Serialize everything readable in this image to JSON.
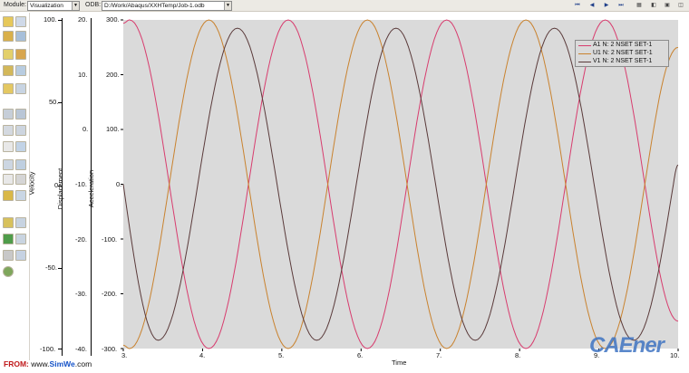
{
  "toolbar": {
    "module_label": "Module:",
    "module_value": "Visualization",
    "odb_label": "ODB:",
    "odb_value": "D:/Work/Abaqus/XXHTemp/Job-1.odb",
    "icons": [
      "first-frame-icon",
      "previous-frame-icon",
      "play-icon",
      "next-frame-icon",
      "last-frame-icon",
      "animation-options-icon",
      "animate-icon",
      "camera-icon",
      "capture-icon"
    ]
  },
  "toolbox": {
    "icons": [
      "plot-undeformed-icon",
      "plot-deformed-icon",
      "plot-contours-icon",
      "plot-symbols-icon",
      "plot-material-orientations-icon",
      "common-options-icon",
      "superimpose-options-icon",
      "field-output-icon",
      "create-xy-data-icon",
      "xy-data-manager-icon",
      "path-icon",
      "probe-values-icon",
      "query-icon",
      "view-cut-icon",
      "display-group-icon",
      "step-frame-icon",
      "animate-time-history-icon",
      "result-options-icon",
      "section-points-icon",
      "tools-icon"
    ]
  },
  "plot": {
    "x_axis_title": "Time",
    "x_ticks": [
      "3.",
      "4.",
      "5.",
      "6.",
      "7.",
      "8.",
      "9.",
      "10."
    ],
    "axes": [
      {
        "title": "Velocity",
        "ticks": [
          "100.",
          "50.",
          "0.",
          "-50.",
          "-100."
        ]
      },
      {
        "title": "Displacement",
        "ticks": [
          "20.",
          "10.",
          "0.",
          "-10.",
          "-20.",
          "-30.",
          "-40."
        ]
      },
      {
        "title": "Acceleration",
        "ticks": [
          "300.",
          "200.",
          "100.",
          "0.",
          "-100.",
          "-200.",
          "-300."
        ]
      }
    ],
    "legend": [
      {
        "label": "A1 N: 2 NSET SET-1",
        "color": "#d83c6e"
      },
      {
        "label": "U1 N: 2 NSET SET-1",
        "color": "#c9822e"
      },
      {
        "label": "V1 N: 2 NSET SET-1",
        "color": "#5a3a3a"
      }
    ]
  },
  "chart_data": {
    "type": "line",
    "title": "",
    "xlabel": "Time",
    "xlim": [
      3,
      10
    ],
    "grid": false,
    "background": "#dadada",
    "legend_position": "top-right",
    "y_axes": [
      {
        "label": "Velocity",
        "lim": [
          -100,
          100
        ]
      },
      {
        "label": "Displacement",
        "lim": [
          -40,
          20
        ]
      },
      {
        "label": "Acceleration",
        "lim": [
          -300,
          300
        ]
      }
    ],
    "series": [
      {
        "name": "A1 N: 2 NSET SET-1",
        "axis": "Acceleration",
        "color": "#d83c6e",
        "x": [
          3.0,
          3.08,
          3.58,
          4.08,
          4.58,
          5.08,
          5.58,
          6.08,
          6.58,
          7.08,
          7.58,
          8.08,
          8.58,
          9.08,
          9.58,
          10.0
        ],
        "y": [
          294,
          300,
          0,
          -300,
          0,
          300,
          0,
          -300,
          0,
          300,
          0,
          -300,
          0,
          300,
          0,
          -250
        ]
      },
      {
        "name": "U1 N: 2 NSET SET-1",
        "axis": "Acceleration",
        "color": "#c9822e",
        "x": [
          3.0,
          3.08,
          3.58,
          4.08,
          4.58,
          5.08,
          5.58,
          6.08,
          6.58,
          7.08,
          7.58,
          8.08,
          8.58,
          9.08,
          9.58,
          10.0
        ],
        "y": [
          -294,
          -300,
          0,
          300,
          0,
          -300,
          0,
          300,
          0,
          -300,
          0,
          300,
          0,
          -300,
          0,
          250
        ]
      },
      {
        "name": "V1 N: 2 NSET SET-1",
        "axis": "Acceleration",
        "color": "#5a3a3a",
        "x": [
          3.0,
          3.44,
          3.94,
          4.44,
          4.94,
          5.44,
          5.94,
          6.44,
          6.94,
          7.44,
          7.94,
          8.44,
          8.94,
          9.44,
          9.94,
          10.0
        ],
        "y": [
          0,
          -285,
          0,
          285,
          0,
          -285,
          0,
          285,
          0,
          -285,
          0,
          285,
          0,
          -285,
          0,
          35
        ]
      }
    ]
  },
  "footer": {
    "from": "FROM:",
    "url_prefix": "www.",
    "url_brand": "SimWe",
    "url_suffix": ".com"
  },
  "watermark": "CAEner"
}
